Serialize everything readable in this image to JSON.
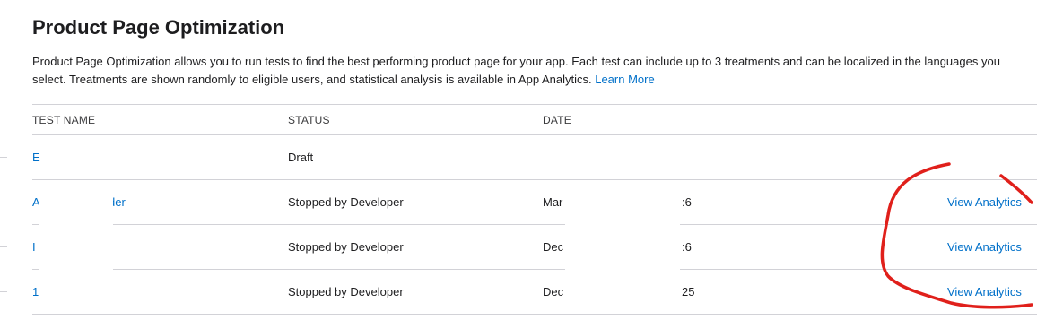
{
  "page": {
    "title": "Product Page Optimization",
    "description": "Product Page Optimization allows you to run tests to find the best performing product page for your app. Each test can include up to 3 treatments and can be localized in the languages you select. Treatments are shown randomly to eligible users, and statistical analysis is available in App Analytics.",
    "learn_more": "Learn More"
  },
  "table": {
    "headers": {
      "name": "TEST NAME",
      "status": "STATUS",
      "date": "DATE"
    },
    "rows": [
      {
        "name": "E",
        "status": "Draft",
        "date_start": "",
        "date_end": "",
        "action": ""
      },
      {
        "name": "A",
        "name_tail": "der",
        "status": "Stopped by Developer",
        "date_start": "Mar",
        "date_end": ":6",
        "action": "View Analytics"
      },
      {
        "name": "I",
        "name_tail": "",
        "status": "Stopped by Developer",
        "date_start": "Dec",
        "date_end": ":6",
        "action": "View Analytics"
      },
      {
        "name": "1",
        "name_tail": "",
        "status": "Stopped by Developer",
        "date_start": "Dec",
        "date_end": "25",
        "action": "View Analytics"
      }
    ]
  },
  "colors": {
    "link": "#0070c9",
    "annotation": "#e0201b",
    "divider": "#d2d2d7"
  }
}
